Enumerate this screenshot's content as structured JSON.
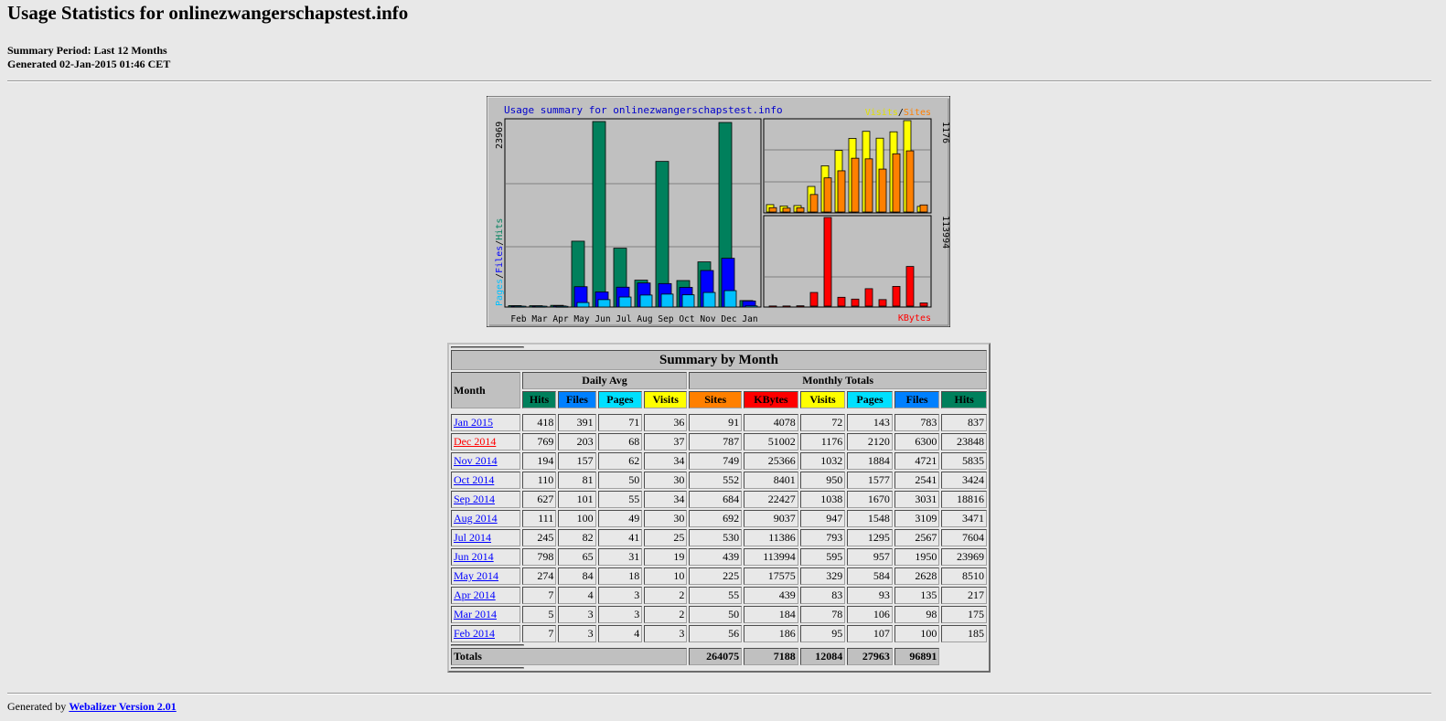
{
  "title": "Usage Statistics for onlinezwangerschapstest.info",
  "summary_period": "Summary Period: Last 12 Months",
  "generated": "Generated 02-Jan-2015 01:46 CET",
  "graph": {
    "caption": "Usage summary for onlinezwangerschapstest.info",
    "left_max_label": "23969",
    "right_top_max_label": "1176",
    "right_bottom_max_label": "113994",
    "legend_pages": "Pages",
    "legend_files": "Files",
    "legend_hits": "Hits",
    "legend_visits": "Visits",
    "legend_sites": "Sites",
    "legend_kbytes": "KBytes",
    "sep": "/",
    "colors": {
      "hits": "#00805C",
      "files": "#0000FF",
      "pages": "#00C0FF",
      "visits": "#FFFF00",
      "sites": "#FF8000",
      "kbytes": "#FF0000"
    }
  },
  "chart_data": {
    "type": "bar",
    "title": "Usage summary for onlinezwangerschapstest.info",
    "categories": [
      "Feb",
      "Mar",
      "Apr",
      "May",
      "Jun",
      "Jul",
      "Aug",
      "Sep",
      "Oct",
      "Nov",
      "Dec",
      "Jan"
    ],
    "series": [
      {
        "name": "Hits",
        "values": [
          185,
          175,
          217,
          8510,
          23969,
          7604,
          3471,
          18816,
          3424,
          5835,
          23848,
          837
        ]
      },
      {
        "name": "Files",
        "values": [
          100,
          98,
          135,
          2628,
          1950,
          2567,
          3109,
          3031,
          2541,
          4721,
          6300,
          783
        ]
      },
      {
        "name": "Pages",
        "values": [
          107,
          106,
          93,
          584,
          957,
          1295,
          1548,
          1670,
          1577,
          1884,
          2120,
          143
        ]
      },
      {
        "name": "Visits",
        "values": [
          95,
          78,
          83,
          329,
          595,
          793,
          947,
          1038,
          950,
          1032,
          1176,
          72
        ]
      },
      {
        "name": "Sites",
        "values": [
          56,
          50,
          55,
          225,
          439,
          530,
          692,
          684,
          552,
          749,
          787,
          91
        ]
      },
      {
        "name": "KBytes",
        "values": [
          186,
          184,
          439,
          17575,
          113994,
          11386,
          9037,
          22427,
          8401,
          25366,
          51002,
          4078
        ]
      }
    ]
  },
  "table": {
    "caption": "Summary by Month",
    "month_header": "Month",
    "daily_avg": "Daily Avg",
    "monthly_totals": "Monthly Totals",
    "cols": {
      "hits": "Hits",
      "files": "Files",
      "pages": "Pages",
      "visits": "Visits",
      "sites": "Sites",
      "kbytes": "KBytes"
    },
    "rows": [
      {
        "month": "Jan 2015",
        "d_hits": "418",
        "d_files": "391",
        "d_pages": "71",
        "d_visits": "36",
        "sites": "91",
        "kbytes": "4078",
        "visits": "72",
        "pages": "143",
        "files": "783",
        "hits": "837"
      },
      {
        "month": "Dec 2014",
        "d_hits": "769",
        "d_files": "203",
        "d_pages": "68",
        "d_visits": "37",
        "sites": "787",
        "kbytes": "51002",
        "visits": "1176",
        "pages": "2120",
        "files": "6300",
        "hits": "23848"
      },
      {
        "month": "Nov 2014",
        "d_hits": "194",
        "d_files": "157",
        "d_pages": "62",
        "d_visits": "34",
        "sites": "749",
        "kbytes": "25366",
        "visits": "1032",
        "pages": "1884",
        "files": "4721",
        "hits": "5835"
      },
      {
        "month": "Oct 2014",
        "d_hits": "110",
        "d_files": "81",
        "d_pages": "50",
        "d_visits": "30",
        "sites": "552",
        "kbytes": "8401",
        "visits": "950",
        "pages": "1577",
        "files": "2541",
        "hits": "3424"
      },
      {
        "month": "Sep 2014",
        "d_hits": "627",
        "d_files": "101",
        "d_pages": "55",
        "d_visits": "34",
        "sites": "684",
        "kbytes": "22427",
        "visits": "1038",
        "pages": "1670",
        "files": "3031",
        "hits": "18816"
      },
      {
        "month": "Aug 2014",
        "d_hits": "111",
        "d_files": "100",
        "d_pages": "49",
        "d_visits": "30",
        "sites": "692",
        "kbytes": "9037",
        "visits": "947",
        "pages": "1548",
        "files": "3109",
        "hits": "3471"
      },
      {
        "month": "Jul 2014",
        "d_hits": "245",
        "d_files": "82",
        "d_pages": "41",
        "d_visits": "25",
        "sites": "530",
        "kbytes": "11386",
        "visits": "793",
        "pages": "1295",
        "files": "2567",
        "hits": "7604"
      },
      {
        "month": "Jun 2014",
        "d_hits": "798",
        "d_files": "65",
        "d_pages": "31",
        "d_visits": "19",
        "sites": "439",
        "kbytes": "113994",
        "visits": "595",
        "pages": "957",
        "files": "1950",
        "hits": "23969"
      },
      {
        "month": "May 2014",
        "d_hits": "274",
        "d_files": "84",
        "d_pages": "18",
        "d_visits": "10",
        "sites": "225",
        "kbytes": "17575",
        "visits": "329",
        "pages": "584",
        "files": "2628",
        "hits": "8510"
      },
      {
        "month": "Apr 2014",
        "d_hits": "7",
        "d_files": "4",
        "d_pages": "3",
        "d_visits": "2",
        "sites": "55",
        "kbytes": "439",
        "visits": "83",
        "pages": "93",
        "files": "135",
        "hits": "217"
      },
      {
        "month": "Mar 2014",
        "d_hits": "5",
        "d_files": "3",
        "d_pages": "3",
        "d_visits": "2",
        "sites": "50",
        "kbytes": "184",
        "visits": "78",
        "pages": "106",
        "files": "98",
        "hits": "175"
      },
      {
        "month": "Feb 2014",
        "d_hits": "7",
        "d_files": "3",
        "d_pages": "4",
        "d_visits": "3",
        "sites": "56",
        "kbytes": "186",
        "visits": "95",
        "pages": "107",
        "files": "100",
        "hits": "185"
      }
    ],
    "totals": {
      "label": "Totals",
      "kbytes": "264075",
      "visits": "7188",
      "pages": "12084",
      "files": "27963",
      "hits": "96891"
    }
  },
  "footer": {
    "prefix": "Generated by ",
    "link": "Webalizer Version 2.01"
  }
}
